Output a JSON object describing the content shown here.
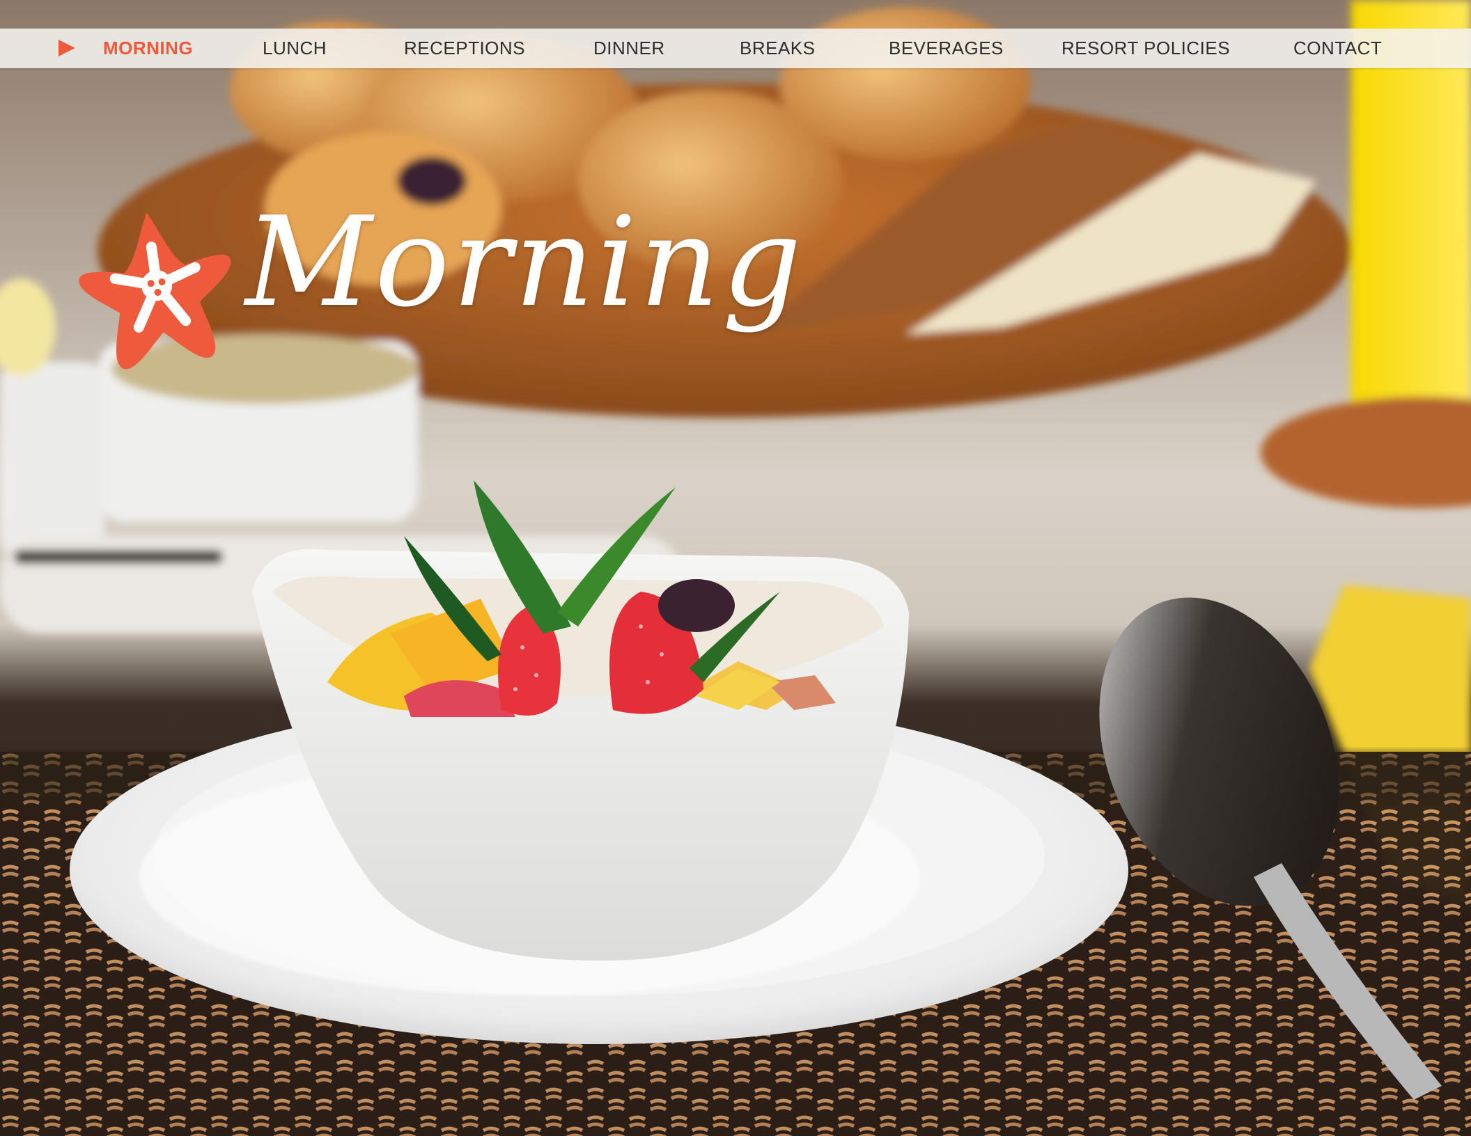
{
  "nav": {
    "items": [
      {
        "label": "MORNING",
        "active": true
      },
      {
        "label": "LUNCH"
      },
      {
        "label": "RECEPTIONS"
      },
      {
        "label": "DINNER"
      },
      {
        "label": "BREAKS"
      },
      {
        "label": "BEVERAGES"
      },
      {
        "label": "RESORT POLICIES"
      },
      {
        "label": "CONTACT"
      }
    ],
    "indicator_icon": "play-arrow-icon"
  },
  "hero": {
    "title": "Morning",
    "logo_icon": "starfish-flower-icon",
    "photo": "breakfast-fruit-bowl-photo"
  },
  "colors": {
    "accent": "#ee5b3c",
    "nav_text": "#2d2d2d",
    "nav_background": "#f4f2ef",
    "title_text": "#ffffff"
  }
}
